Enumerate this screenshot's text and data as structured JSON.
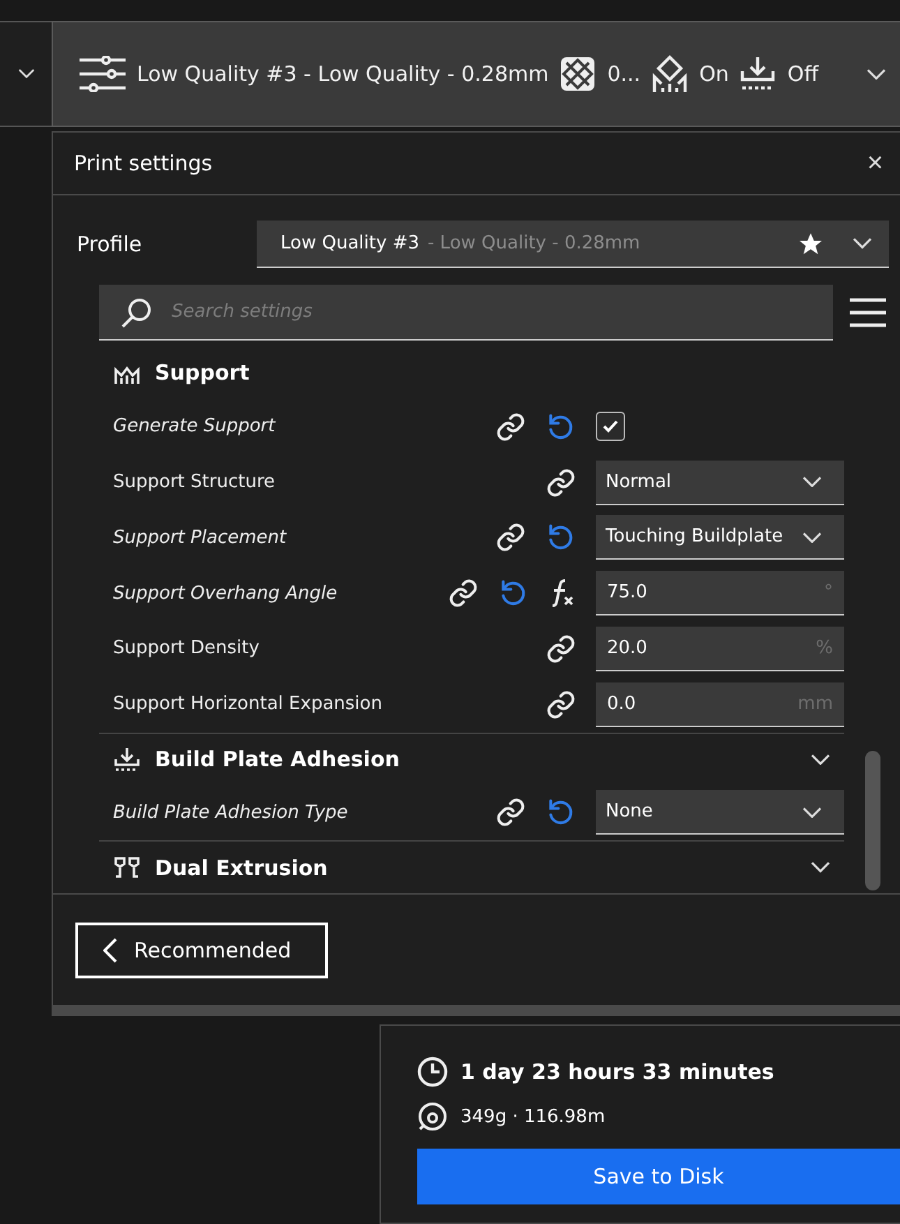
{
  "top_bar": {
    "profile": "Low Quality #3 - Low Quality - 0.28mm",
    "infill": "0...",
    "support": "On",
    "adhesion": "Off"
  },
  "print_settings": {
    "title": "Print settings",
    "close": "×",
    "profile": {
      "label": "Profile",
      "name": "Low Quality #3",
      "detail": "- Low Quality - 0.28mm",
      "favorite": true
    },
    "search": {
      "placeholder": "Search settings"
    },
    "sections": [
      {
        "kind": "support",
        "title": "Support",
        "settings": [
          {
            "label": "Generate Support",
            "modified": true,
            "linked": true,
            "reset": true,
            "formula": false,
            "kind": "checkbox",
            "checked": true
          },
          {
            "label": "Support Structure",
            "modified": false,
            "linked": true,
            "reset": false,
            "formula": false,
            "kind": "dropdown",
            "value": "Normal"
          },
          {
            "label": "Support Placement",
            "modified": true,
            "linked": true,
            "reset": true,
            "formula": false,
            "kind": "dropdown",
            "value": "Touching Buildplate"
          },
          {
            "label": "Support Overhang Angle",
            "modified": true,
            "linked": true,
            "reset": true,
            "formula": true,
            "kind": "number",
            "value": "75.0",
            "unit": "°"
          },
          {
            "label": "Support Density",
            "modified": false,
            "linked": true,
            "reset": false,
            "formula": false,
            "kind": "number",
            "value": "20.0",
            "unit": "%"
          },
          {
            "label": "Support Horizontal Expansion",
            "modified": false,
            "linked": true,
            "reset": false,
            "formula": false,
            "kind": "number",
            "value": "0.0",
            "unit": "mm"
          }
        ]
      },
      {
        "kind": "adhesion",
        "title": "Build Plate Adhesion",
        "settings": [
          {
            "label": "Build Plate Adhesion Type",
            "modified": true,
            "linked": true,
            "reset": true,
            "formula": false,
            "kind": "dropdown",
            "value": "None"
          }
        ]
      },
      {
        "kind": "dual",
        "title": "Dual Extrusion"
      }
    ],
    "recommended_button": "Recommended"
  },
  "print_info": {
    "time": "1 day 23 hours 33 minutes",
    "material": "349g · 116.98m",
    "save_button": "Save to Disk"
  }
}
